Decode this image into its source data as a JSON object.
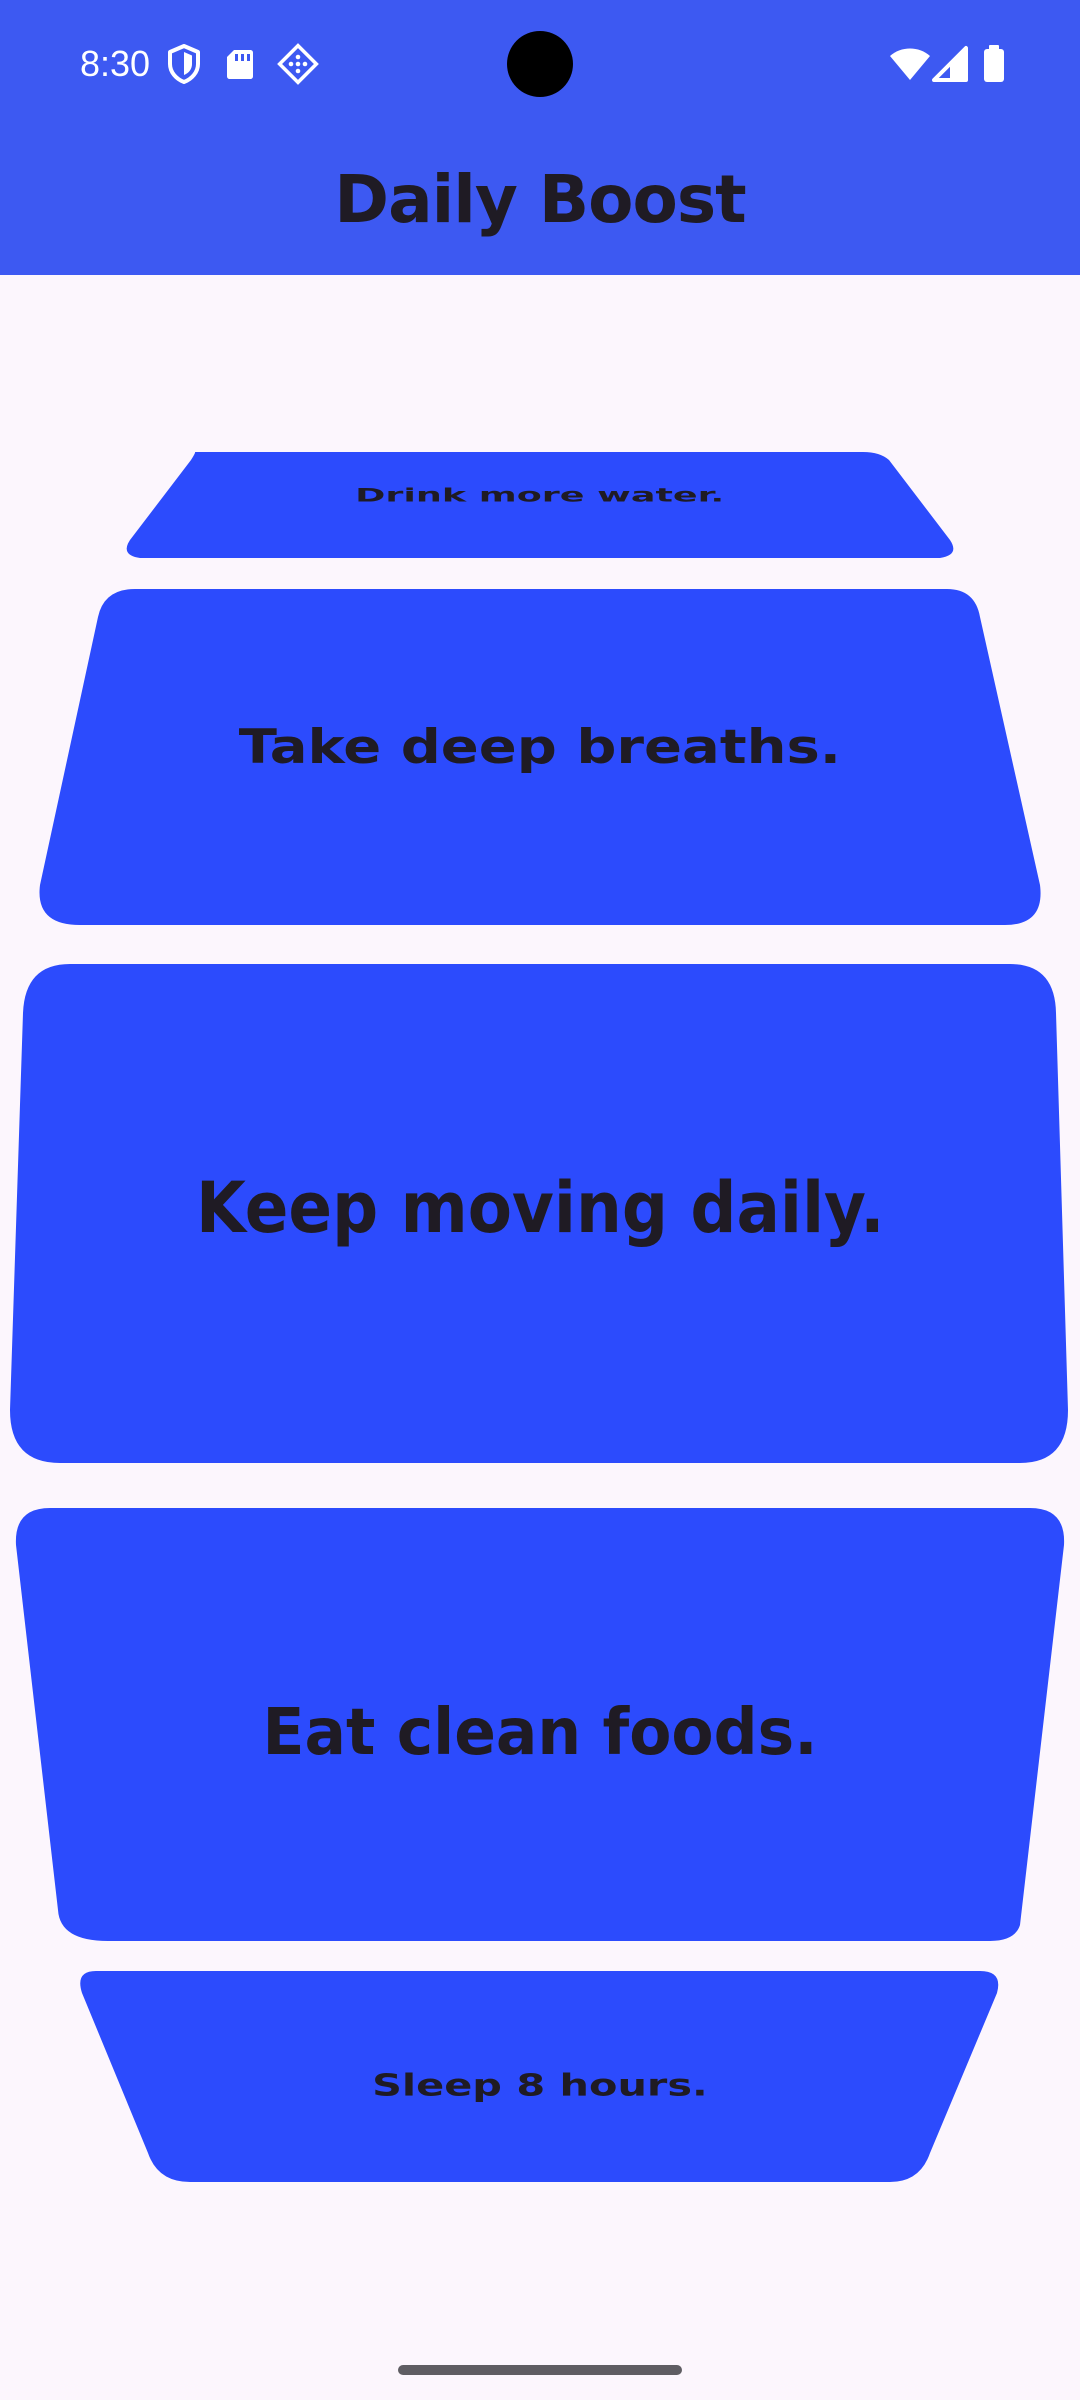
{
  "status_bar": {
    "time": "8:30",
    "left_icons": [
      "shield-icon",
      "sd-card-icon",
      "cast-diamond-icon"
    ],
    "right_icons": [
      "wifi-icon",
      "signal-icon",
      "battery-icon"
    ]
  },
  "app_bar": {
    "title": "Daily Boost",
    "background": "#3d59f2"
  },
  "carousel": {
    "card_color": "#2c4bfd",
    "items": [
      {
        "label": "Drink more water."
      },
      {
        "label": "Take deep breaths."
      },
      {
        "label": "Keep moving daily."
      },
      {
        "label": "Eat clean foods."
      },
      {
        "label": "Sleep 8 hours."
      }
    ]
  }
}
